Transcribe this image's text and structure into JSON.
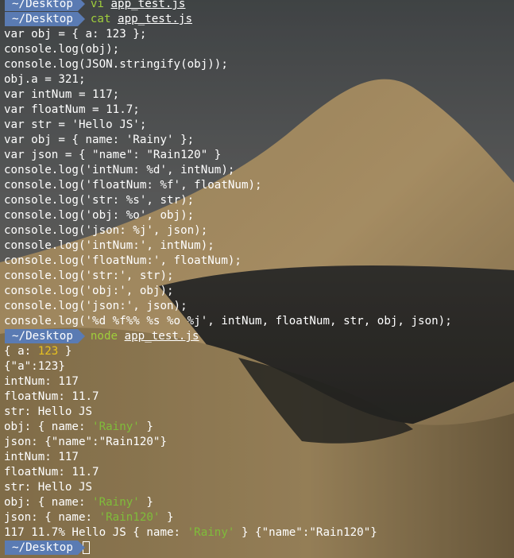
{
  "prompt": {
    "path": "~/Desktop"
  },
  "commands": [
    {
      "cmd": "vi",
      "arg": "app_test.js"
    },
    {
      "cmd": "cat",
      "arg": "app_test.js"
    },
    {
      "cmd": "node",
      "arg": "app_test.js"
    }
  ],
  "source_lines": [
    "var obj = { a: 123 };",
    "console.log(obj);",
    "console.log(JSON.stringify(obj));",
    "obj.a = 321;",
    "var intNum = 117;",
    "var floatNum = 11.7;",
    "var str = 'Hello JS';",
    "var obj = { name: 'Rainy' };",
    "var json = { \"name\": \"Rain120\" }",
    "console.log('intNum: %d', intNum);",
    "console.log('floatNum: %f', floatNum);",
    "console.log('str: %s', str);",
    "console.log('obj: %o', obj);",
    "console.log('json: %j', json);",
    "console.log('intNum:', intNum);",
    "console.log('floatNum:', floatNum);",
    "console.log('str:', str);",
    "console.log('obj:', obj);",
    "console.log('json:', json);",
    "console.log('%d %f%% %s %o %j', intNum, floatNum, str, obj, json);"
  ],
  "output": {
    "l1": {
      "pre": "{ a: ",
      "num": "123",
      "post": " }"
    },
    "l2": "{\"a\":123}",
    "l3": "intNum: 117",
    "l4": "floatNum: 11.7",
    "l5": "str: Hello JS",
    "l6": {
      "pre": "obj: { name: ",
      "str": "'Rainy'",
      "post": " }"
    },
    "l7": "json: {\"name\":\"Rain120\"}",
    "l8": "intNum: 117",
    "l9": "floatNum: 11.7",
    "l10": "str: Hello JS",
    "l11": {
      "pre": "obj: { name: ",
      "str": "'Rainy'",
      "post": " }"
    },
    "l12": {
      "pre": "json: { name: ",
      "str": "'Rain120'",
      "post": " }"
    },
    "l13": {
      "pre": "117 11.7% Hello JS { name: ",
      "str": "'Rainy'",
      "post": " } {\"name\":\"Rain120\"}"
    }
  },
  "colors": {
    "prompt_bg": "#5a7bb3",
    "command": "#9fce3c",
    "number": "#e6c020",
    "string": "#7fbd3a",
    "text": "#ffffff"
  }
}
